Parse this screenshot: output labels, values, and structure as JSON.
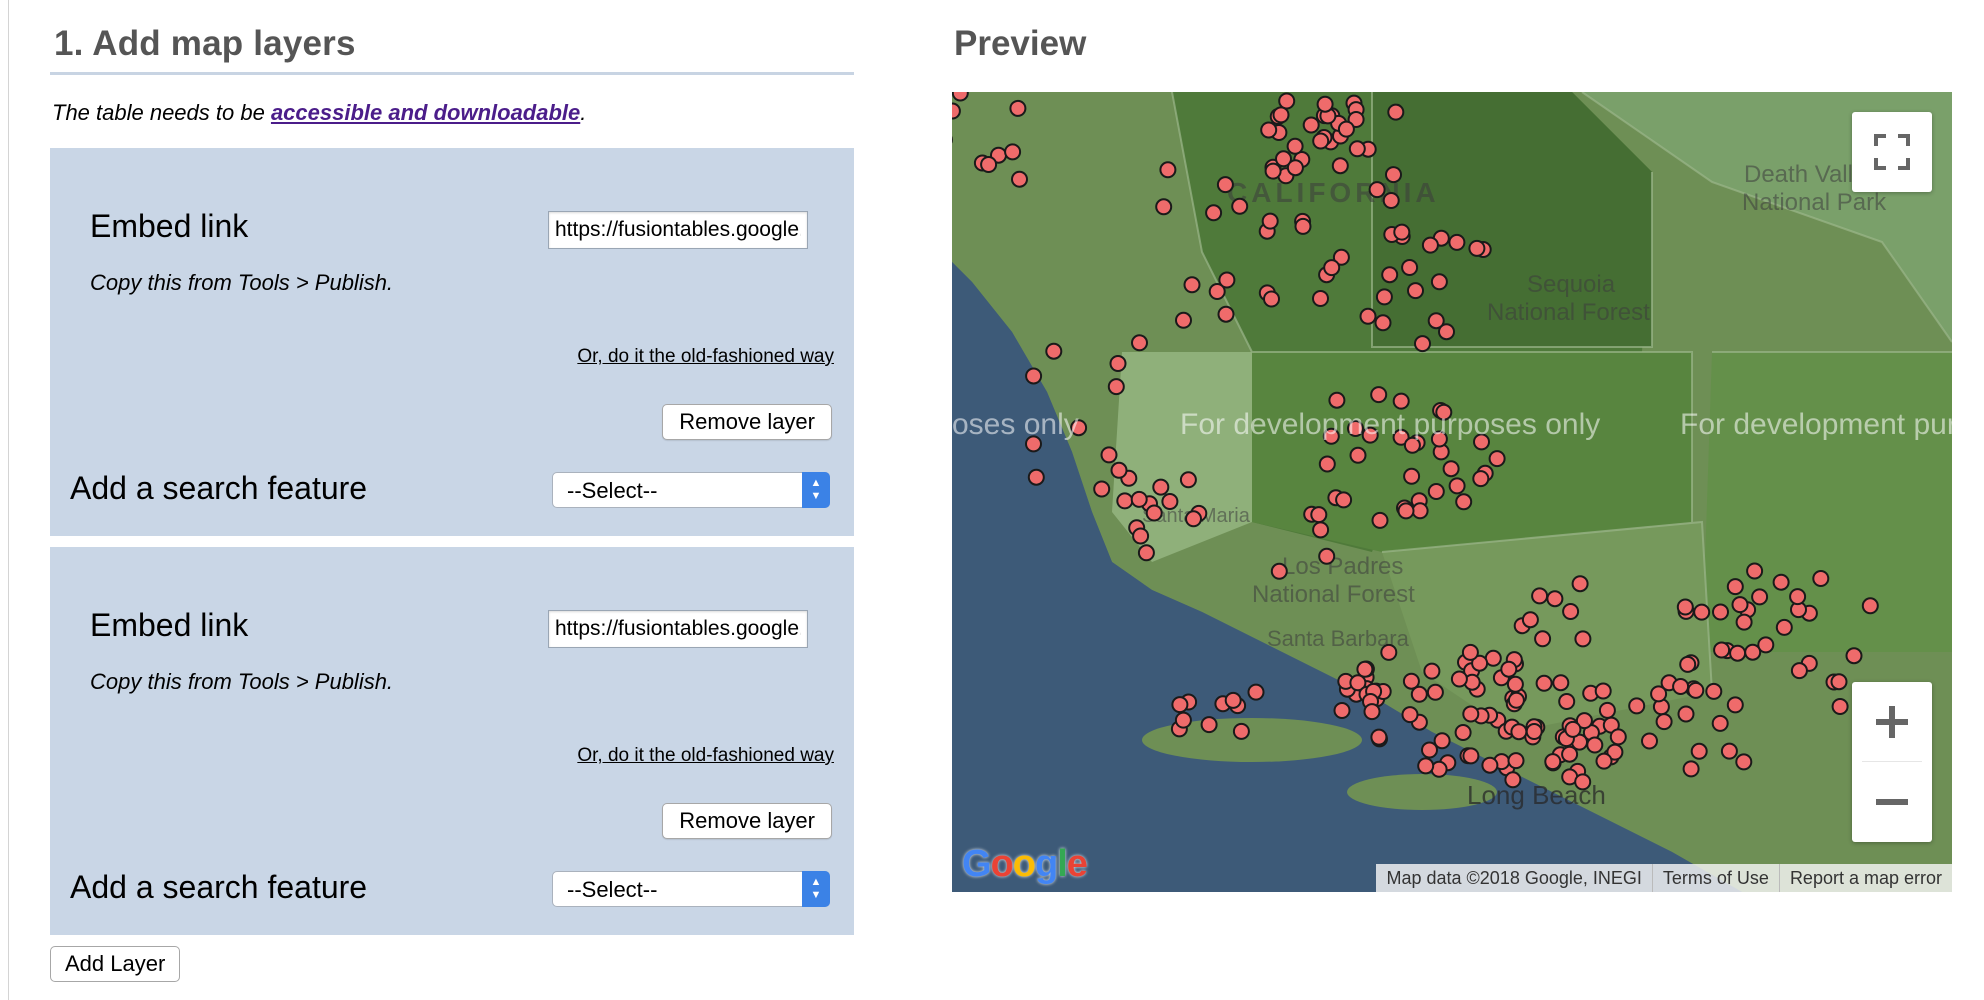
{
  "section1": {
    "title": "1. Add map layers",
    "note_prefix": "The table needs to be ",
    "note_link": "accessible and downloadable",
    "note_suffix": "."
  },
  "layers": [
    {
      "embed_label": "Embed link",
      "embed_value": "https://fusiontables.google.com/embedviz",
      "copy_hint": "Copy this from Tools > Publish.",
      "old_way_link": "Or, do it the old-fashioned way",
      "remove_button": "Remove layer",
      "search_label": "Add a search feature",
      "search_select": "--Select--"
    },
    {
      "embed_label": "Embed link",
      "embed_value": "https://fusiontables.google.com/embedviz",
      "copy_hint": "Copy this from Tools > Publish.",
      "old_way_link": "Or, do it the old-fashioned way",
      "remove_button": "Remove layer",
      "search_label": "Add a search feature",
      "search_select": "--Select--"
    }
  ],
  "add_layer_button": "Add Layer",
  "preview": {
    "title": "Preview",
    "map": {
      "watermark": [
        "oses only",
        "For development purposes only",
        "For development pur"
      ],
      "attribution": [
        "Map data ©2018 Google, INEGI",
        "Terms of Use",
        "Report a map error"
      ],
      "google_logo": [
        "G",
        "o",
        "o",
        "g",
        "l",
        "e"
      ],
      "logo_colors": [
        "#4285f4",
        "#ea4335",
        "#fbbc05",
        "#4285f4",
        "#34a853",
        "#ea4335"
      ],
      "place_labels": [
        "CALIFORNIA",
        "Death Valley",
        "National Park",
        "Sequoia",
        "National Forest",
        "Santa Maria",
        "Los Padres",
        "National Forest",
        "Santa Barbara",
        "Long Beach"
      ],
      "marker_color": "#ef6b6b",
      "icons": [
        "fullscreen-icon",
        "zoom-in-icon",
        "zoom-out-icon"
      ]
    }
  }
}
